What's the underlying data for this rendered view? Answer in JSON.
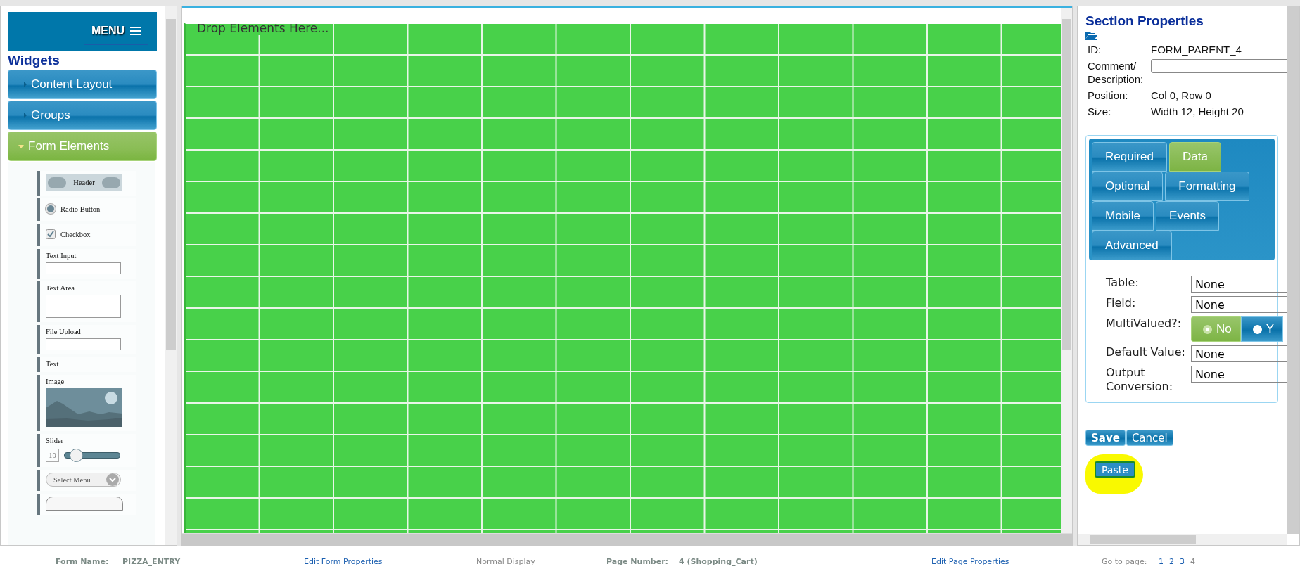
{
  "menu": {
    "label": "MENU"
  },
  "widgets": {
    "title": "Widgets",
    "sections": [
      {
        "label": "Content Layout",
        "expanded": false
      },
      {
        "label": "Groups",
        "expanded": false
      },
      {
        "label": "Form Elements",
        "expanded": true
      }
    ],
    "items": [
      {
        "kind": "header",
        "label": "Header"
      },
      {
        "kind": "radio",
        "label": "Radio Button"
      },
      {
        "kind": "checkbox",
        "label": "Checkbox"
      },
      {
        "kind": "input",
        "label": "Text Input"
      },
      {
        "kind": "textarea",
        "label": "Text Area"
      },
      {
        "kind": "input",
        "label": "File Upload"
      },
      {
        "kind": "text",
        "label": "Text"
      },
      {
        "kind": "image",
        "label": "Image"
      },
      {
        "kind": "slider",
        "label": "Slider",
        "value": "10",
        "level": 0.2
      },
      {
        "kind": "select",
        "label": "Select Menu"
      },
      {
        "kind": "button"
      }
    ]
  },
  "canvas": {
    "hint": "Drop Elements Here..."
  },
  "properties": {
    "title": "Section Properties",
    "info": [
      {
        "label": "ID:",
        "value": "FORM_PARENT_4"
      },
      {
        "label": "Comment/ Description:",
        "kind": "field"
      },
      {
        "label": "Position:",
        "value": "Col 0, Row 0"
      },
      {
        "label": "Size:",
        "value": "Width 12, Height 20"
      }
    ],
    "tabs": [
      [
        {
          "label": "Required",
          "selected": false
        },
        {
          "label": "Data",
          "selected": true
        }
      ],
      [
        {
          "label": "Optional",
          "selected": false
        },
        {
          "label": "Formatting",
          "selected": false
        }
      ],
      [
        {
          "label": "Mobile",
          "selected": false
        },
        {
          "label": "Events",
          "selected": false
        }
      ],
      [
        {
          "label": "Advanced",
          "selected": false
        }
      ]
    ],
    "fields": [
      {
        "label": "Table:",
        "kind": "select",
        "value": "None"
      },
      {
        "label": "Field:",
        "kind": "select",
        "value": "None"
      },
      {
        "label": "MultiValued?:",
        "kind": "toggle",
        "options": [
          {
            "label": "No",
            "selected": true
          },
          {
            "label": "Y",
            "selected": false
          }
        ]
      },
      {
        "label": "Default Value:",
        "kind": "select",
        "value": "None"
      },
      {
        "label": "Output Conversion:",
        "kind": "select",
        "value": "None"
      }
    ],
    "buttons": [
      "Save",
      "Cancel"
    ],
    "paste": {
      "label": "Paste",
      "highlighted": true
    }
  },
  "status_bar": {
    "form_name_label": "Form Name:",
    "form_name": "PIZZA_ENTRY",
    "edit_form": "Edit Form Properties",
    "display": "Normal Display",
    "page_number_label": "Page Number:",
    "page_number": "4 (Shopping_Cart)",
    "edit_page": "Edit Page Properties",
    "goto_label": "Go to page:",
    "pages": [
      {
        "label": "1",
        "selected": false
      },
      {
        "label": "2",
        "selected": false
      },
      {
        "label": "3",
        "selected": false
      },
      {
        "label": "4",
        "selected": true
      }
    ]
  }
}
